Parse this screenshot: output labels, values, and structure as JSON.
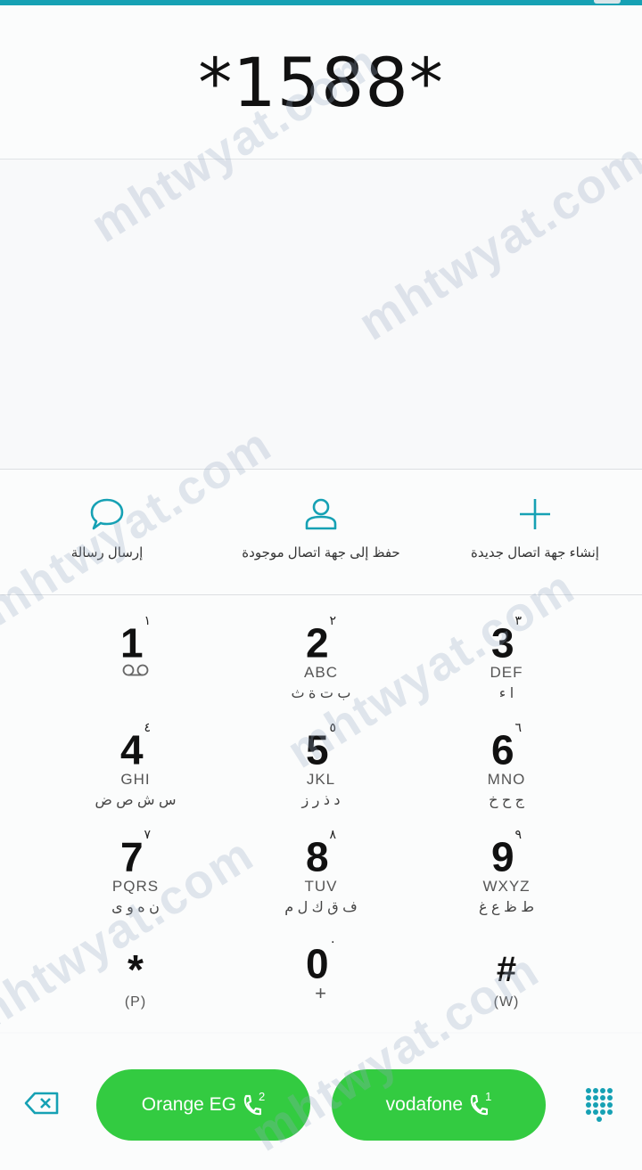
{
  "dialed_number": "*1588*",
  "actions": [
    {
      "label": "إرسال رسالة",
      "icon": "message-bubble-icon"
    },
    {
      "label": "حفظ إلى جهة اتصال موجودة",
      "icon": "person-icon"
    },
    {
      "label": "إنشاء جهة اتصال جديدة",
      "icon": "plus-icon"
    }
  ],
  "keys": [
    {
      "digit": "1",
      "arabic_digit": "١",
      "letters": "",
      "arabic_letters": ""
    },
    {
      "digit": "2",
      "arabic_digit": "٢",
      "letters": "ABC",
      "arabic_letters": "ب ت ة ث"
    },
    {
      "digit": "3",
      "arabic_digit": "٣",
      "letters": "DEF",
      "arabic_letters": "ا ء"
    },
    {
      "digit": "4",
      "arabic_digit": "٤",
      "letters": "GHI",
      "arabic_letters": "س ش ص ض"
    },
    {
      "digit": "5",
      "arabic_digit": "٥",
      "letters": "JKL",
      "arabic_letters": "د ذ ر ز"
    },
    {
      "digit": "6",
      "arabic_digit": "٦",
      "letters": "MNO",
      "arabic_letters": "ج ح خ"
    },
    {
      "digit": "7",
      "arabic_digit": "٧",
      "letters": "PQRS",
      "arabic_letters": "ن ه و ى"
    },
    {
      "digit": "8",
      "arabic_digit": "٨",
      "letters": "TUV",
      "arabic_letters": "ف ق ك ل م"
    },
    {
      "digit": "9",
      "arabic_digit": "٩",
      "letters": "WXYZ",
      "arabic_letters": "ط ظ ع غ"
    },
    {
      "digit": "*",
      "arabic_digit": "",
      "letters": "(P)",
      "arabic_letters": ""
    },
    {
      "digit": "0",
      "arabic_digit": "٠",
      "letters": "+",
      "arabic_letters": ""
    },
    {
      "digit": "#",
      "arabic_digit": "",
      "letters": "(W)",
      "arabic_letters": ""
    }
  ],
  "call_buttons": [
    {
      "label": "Orange EG",
      "sim": "2"
    },
    {
      "label": "vodafone",
      "sim": "1"
    }
  ],
  "watermark": "mhtwyat.com",
  "colors": {
    "accent": "#16a1b4",
    "call_green": "#33cb41"
  }
}
